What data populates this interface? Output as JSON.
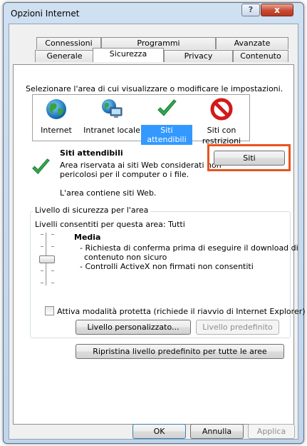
{
  "window": {
    "title": "Opzioni Internet",
    "help_label": "?",
    "close_label": "x"
  },
  "tabs": {
    "row_back": [
      "Connessioni",
      "Programmi",
      "Avanzate"
    ],
    "row_front": [
      "Generale",
      "Sicurezza",
      "Privacy",
      "Contenuto"
    ],
    "active": "Sicurezza"
  },
  "security": {
    "instruction": "Selezionare l'area di cui visualizzare o modificare le impostazioni.",
    "zones": [
      {
        "label": "Internet",
        "icon": "globe-icon"
      },
      {
        "label": "Intranet locale",
        "icon": "intranet-globe-icon"
      },
      {
        "label": "Siti attendibili",
        "icon": "checkmark-icon",
        "selected": true
      },
      {
        "label_line1": "Siti con",
        "label_line2": "restrizioni",
        "icon": "no-entry-icon"
      }
    ],
    "zone_title": "Siti attendibili",
    "zone_desc_line1": "Area riservata ai siti Web considerati non",
    "zone_desc_line2": "pericolosi per il computer o i file.",
    "zone_contains": "L'area contiene siti Web.",
    "sites_button": "Siti",
    "highlight_color": "#e8531f"
  },
  "level_group": {
    "legend": "Livello di sicurezza per l'area",
    "allowed": "Livelli consentiti per questa area: Tutti",
    "level_name": "Media",
    "bullet1_line1": "- Richiesta di conferma prima di eseguire il download di",
    "bullet1_line2": "contenuto non sicuro",
    "bullet2": "- Controlli ActiveX non firmati non consentiti",
    "protected_mode_label": "Attiva modalità protetta (richiede il riavvio di Internet Explorer)",
    "protected_mode_checked": false,
    "custom_level_button": "Livello personalizzato...",
    "default_level_button": "Livello predefinito"
  },
  "reset_button": "Ripristina livello predefinito per tutte le aree",
  "footer": {
    "ok": "OK",
    "cancel": "Annulla",
    "apply": "Applica"
  }
}
